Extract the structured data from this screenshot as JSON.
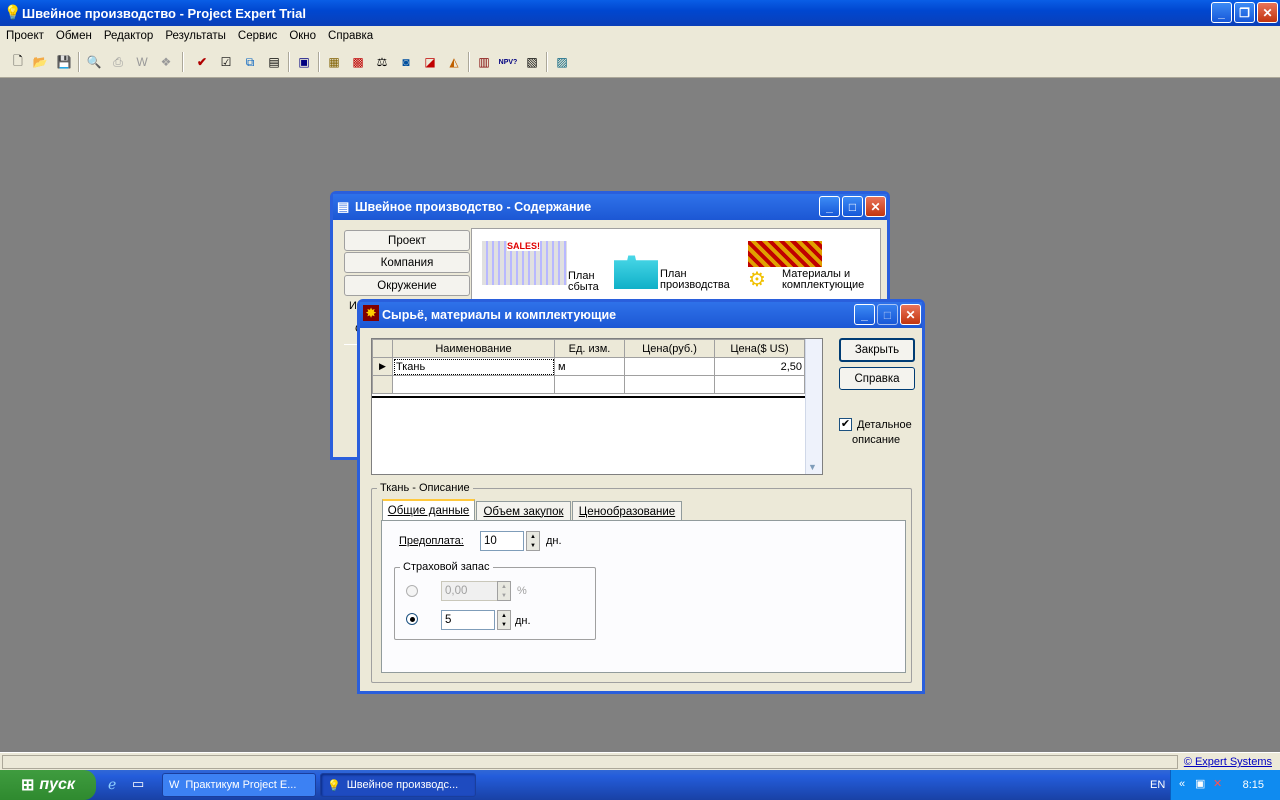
{
  "app": {
    "title": "Швейное производство - Project Expert Trial"
  },
  "menu": [
    "Проект",
    "Обмен",
    "Редактор",
    "Результаты",
    "Сервис",
    "Окно",
    "Справка"
  ],
  "contents_window": {
    "title": "Швейное производство - Содержание",
    "side_buttons": [
      "Проект",
      "Компания",
      "Окружение"
    ],
    "partial_labels": [
      "И",
      "О"
    ],
    "modules": [
      {
        "label": "План сбыта",
        "picture_text": "SALES!"
      },
      {
        "label": "План производства"
      },
      {
        "label": "Материалы и комплектующие"
      }
    ]
  },
  "materials_dialog": {
    "title": "Сырьё, материалы и комплектующие",
    "columns": [
      "Наименование",
      "Ед. изм.",
      "Цена(руб.)",
      "Цена($ US)"
    ],
    "rows": [
      {
        "name": "Ткань",
        "unit": "м",
        "price_rub": "",
        "price_usd": "2,50"
      }
    ],
    "close_button": "Закрыть",
    "help_button": "Справка",
    "detail_checkbox": {
      "label_line1": "Детальное",
      "label_line2": "описание",
      "checked": true
    },
    "description_group": "Ткань - Описание",
    "tabs": [
      "Общие данные",
      "Объем закупок",
      "Ценообразование"
    ],
    "active_tab": "Общие данные",
    "prepayment_label": "Предоплата:",
    "prepayment_value": "10",
    "days_unit": "дн.",
    "safety_group": "Страховой запас",
    "safety_percent_value": "0,00",
    "percent_unit": "%",
    "safety_days_value": "5",
    "safety_mode": "days"
  },
  "status": {
    "link": "© Expert Systems"
  },
  "taskbar": {
    "start": "пуск",
    "tasks": [
      "Практикум Project E...",
      "Швейное производс..."
    ],
    "lang": "EN",
    "clock": "8:15"
  }
}
